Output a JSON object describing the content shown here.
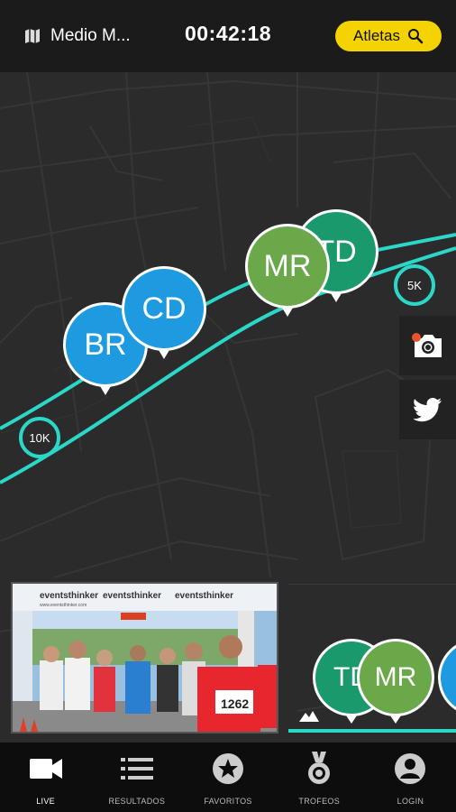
{
  "header": {
    "race_name": "Medio M...",
    "timer": "00:42:18",
    "athletes_button": "Atletas"
  },
  "map": {
    "markers": [
      {
        "initials": "BR",
        "color": "#1e9be0"
      },
      {
        "initials": "CD",
        "color": "#1e9be0"
      },
      {
        "initials": "TD",
        "color": "#1a9a6c"
      },
      {
        "initials": "MR",
        "color": "#6aa84a"
      }
    ],
    "km_markers": [
      "10K",
      "5K"
    ],
    "route_color": "#2bd8c8"
  },
  "side_actions": [
    {
      "icon": "camera-icon"
    },
    {
      "icon": "twitter-icon"
    }
  ],
  "photo_card": {
    "banner_brand": "eventsthinker",
    "banner_url": "www.eventsthinker.com",
    "bib_number": "1262"
  },
  "mini_map": {
    "markers": [
      {
        "initials": "TD",
        "color": "#1a9a6c"
      },
      {
        "initials": "MR",
        "color": "#6aa84a"
      }
    ]
  },
  "nav": {
    "items": [
      {
        "label": "LIVE",
        "icon": "video-camera-icon",
        "active": true
      },
      {
        "label": "RESULTADOS",
        "icon": "list-icon",
        "active": false
      },
      {
        "label": "FAVORITOS",
        "icon": "star-icon",
        "active": false
      },
      {
        "label": "TROFEOS",
        "icon": "medal-icon",
        "active": false
      },
      {
        "label": "LOGIN",
        "icon": "user-icon",
        "active": false
      }
    ]
  }
}
